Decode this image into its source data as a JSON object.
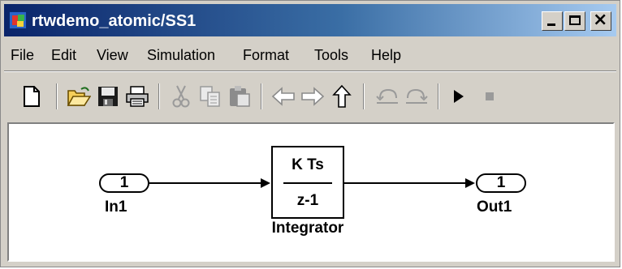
{
  "window": {
    "title": "rtwdemo_atomic/SS1",
    "buttons": {
      "minimize": "_",
      "maximize": "□",
      "close": "×"
    }
  },
  "menu": [
    "File",
    "Edit",
    "View",
    "Simulation",
    "Format",
    "Tools",
    "Help"
  ],
  "toolbar": [
    "new-icon",
    "open-icon",
    "save-icon",
    "print-icon",
    "cut-icon",
    "copy-icon",
    "paste-icon",
    "back-icon",
    "forward-icon",
    "up-icon",
    "undo-icon",
    "redo-icon",
    "run-icon",
    "stop-icon"
  ],
  "diagram": {
    "inport": {
      "number": "1",
      "label": "In1"
    },
    "integrator": {
      "numerator": "K Ts",
      "denominator": "z-1",
      "label": "Integrator"
    },
    "outport": {
      "number": "1",
      "label": "Out1"
    }
  },
  "colors": {
    "title_left": "#0a246a",
    "title_right": "#a6caf0",
    "chrome": "#d4d0c8"
  }
}
